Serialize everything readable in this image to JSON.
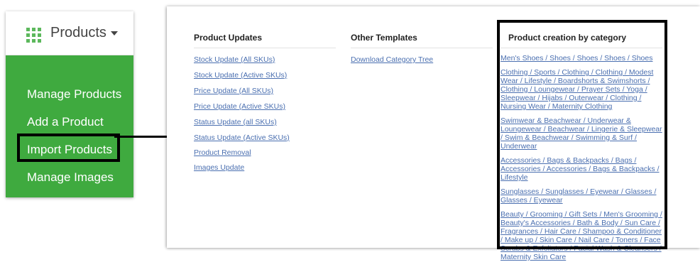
{
  "menu": {
    "title": "Products",
    "items": [
      "Manage Products",
      "Add a Product",
      "Import Products",
      "Manage Images"
    ],
    "highlighted_item": "Import Products",
    "accent_color": "#3faa3f",
    "icon": "grid-icon"
  },
  "import_panel": {
    "columns": [
      {
        "heading": "Product Updates",
        "links": [
          "Stock Update (All SKUs)",
          "Stock Update (Active SKUs)",
          "Price Update (All SKUs)",
          "Price Update (Active SKUs)",
          "Status Update (all SKUs)",
          "Status Update (Active SKUs)",
          "Product Removal",
          "Images Update"
        ]
      },
      {
        "heading": "Other Templates",
        "links": [
          "Download Category Tree"
        ]
      },
      {
        "heading": "Product creation by category",
        "links": [
          "Men's Shoes / Shoes / Shoes / Shoes / Shoes",
          "Clothing / Sports / Clothing / Clothing / Modest Wear / Lifestyle / Boardshorts & Swimshorts / Clothing / Loungewear / Prayer Sets / Yoga / Sleepwear / Hijabs / Outerwear / Clothing / Nursing Wear / Maternity Clothing",
          "Swimwear & Beachwear / Underwear & Loungewear / Beachwear / Lingerie & Sleepwear / Swim & Beachwear / Swimming & Surf / Underwear",
          "Accessories / Bags & Backpacks / Bags / Accessories / Accessories / Bags & Backpacks / Lifestyle",
          "Sunglasses / Sunglasses / Eyewear / Glasses / Glasses / Eyewear",
          "Beauty / Grooming / Gift Sets / Men's Grooming / Beauty's Accessories / Bath & Body / Sun Care / Fragrances / Hair Care / Shampoo & Conditioner / Make up / Skin Care / Nail Care / Toners / Face Scrubs & Exfoliators / Facial Wash & Cleansers / Maternity Skin Care"
        ]
      }
    ],
    "link_color": "#4a6fb0"
  }
}
